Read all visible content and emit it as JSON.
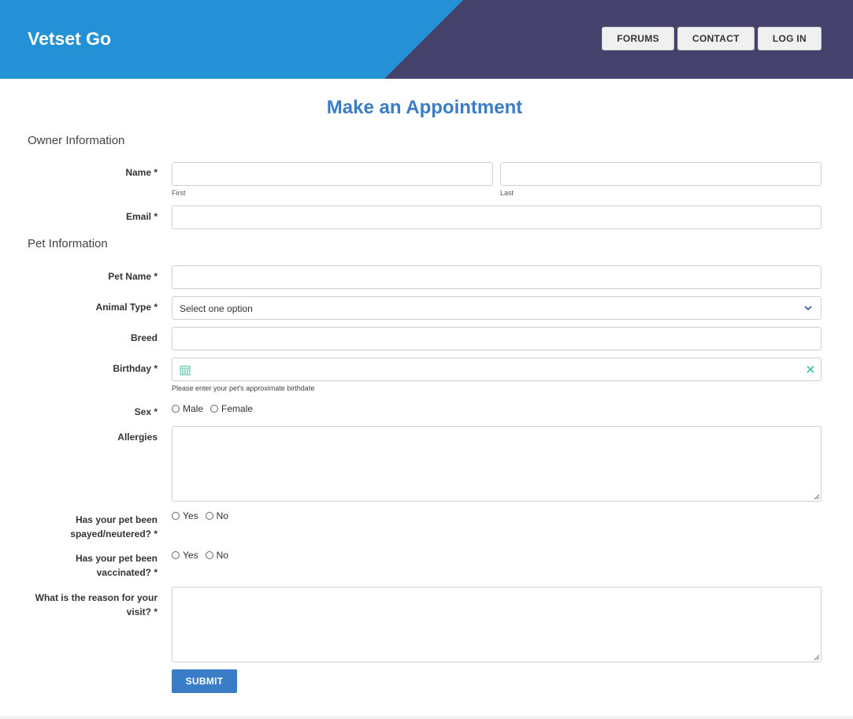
{
  "header": {
    "brand": "Vetset Go",
    "nav": [
      "FORUMS",
      "CONTACT",
      "LOG IN"
    ],
    "colors": {
      "blue": "#2491d6",
      "purple": "#45426e"
    }
  },
  "page_title": "Make an Appointment",
  "sections": {
    "owner": "Owner Information",
    "pet": "Pet Information"
  },
  "owner": {
    "name_label": "Name *",
    "first_value": "",
    "last_value": "",
    "first_sub": "First",
    "last_sub": "Last",
    "email_label": "Email *",
    "email_value": ""
  },
  "pet": {
    "pet_name_label": "Pet Name *",
    "pet_name_value": "",
    "animal_type_label": "Animal Type *",
    "animal_type_value": "Select one option",
    "breed_label": "Breed",
    "breed_value": "",
    "birthday_label": "Birthday *",
    "birthday_value": "",
    "birthday_help": "Please enter your pet's approximate birthdate",
    "sex_label": "Sex *",
    "sex_options": [
      "Male",
      "Female"
    ],
    "allergies_label": "Allergies",
    "spayed_label_1": "Has your pet been",
    "spayed_label_2": "spayed/neutered? *",
    "spayed_options": [
      "Yes",
      "No"
    ],
    "vaccinated_label_1": "Has your pet been",
    "vaccinated_label_2": "vaccinated? *",
    "vaccinated_options": [
      "Yes",
      "No"
    ],
    "reason_label_1": "What is the reason for your",
    "reason_label_2": "visit? *"
  },
  "submit_label": "SUBMIT",
  "accent_color": "#3a7cc6"
}
